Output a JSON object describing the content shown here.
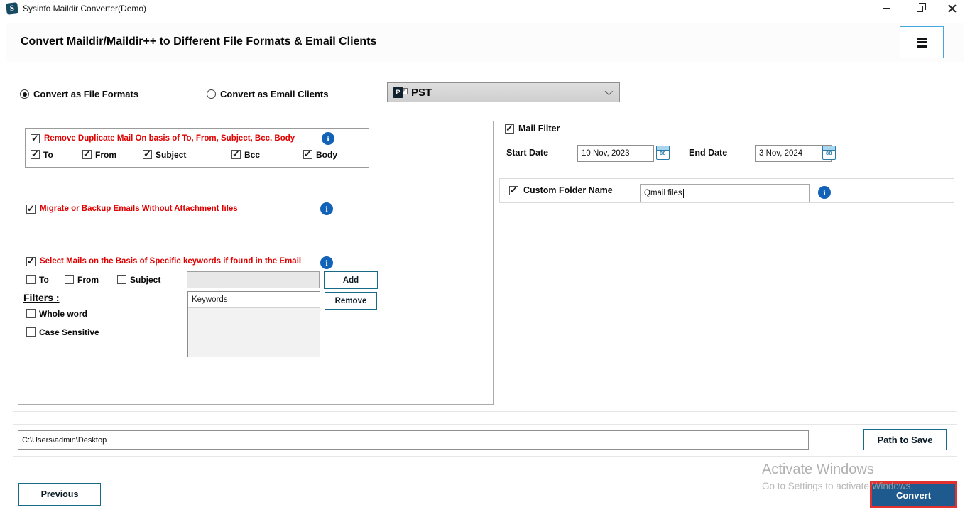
{
  "titlebar": {
    "title": "Sysinfo Maildir Converter(Demo)",
    "icon_letter": "S"
  },
  "header": {
    "title": "Convert Maildir/Maildir++ to Different File Formats & Email Clients"
  },
  "mode": {
    "file_formats": {
      "label": "Convert as File Formats",
      "selected": true
    },
    "email_clients": {
      "label": "Convert as Email Clients",
      "selected": false
    }
  },
  "format_select": {
    "value": "PST",
    "icon_letter": "P"
  },
  "options": {
    "remove_duplicates": {
      "label": "Remove Duplicate Mail On basis of To, From, Subject, Bcc, Body",
      "checked": true,
      "fields": [
        {
          "label": "To",
          "checked": true
        },
        {
          "label": "From",
          "checked": true
        },
        {
          "label": "Subject",
          "checked": true
        },
        {
          "label": "Bcc",
          "checked": true
        },
        {
          "label": "Body",
          "checked": true
        }
      ]
    },
    "no_attachments": {
      "label": "Migrate or Backup Emails Without Attachment files",
      "checked": true
    },
    "keywords_section": {
      "label": "Select Mails on the Basis of Specific keywords if found in the Email",
      "checked": true,
      "fields": [
        {
          "label": "To",
          "checked": false
        },
        {
          "label": "From",
          "checked": false
        },
        {
          "label": "Subject",
          "checked": false
        }
      ],
      "keyword_input_value": "",
      "add_label": "Add",
      "remove_label": "Remove",
      "list_header": "Keywords",
      "filters_label": "Filters :",
      "filters": [
        {
          "label": "Whole word",
          "checked": false
        },
        {
          "label": "Case Sensitive",
          "checked": false
        }
      ]
    }
  },
  "mail_filter": {
    "label": "Mail Filter",
    "checked": true,
    "start_date": {
      "label": "Start Date",
      "value": "10 Nov, 2023"
    },
    "end_date": {
      "label": "End Date",
      "value": "3 Nov, 2024"
    }
  },
  "custom_folder": {
    "label": "Custom Folder Name",
    "checked": true,
    "value": "Qmail files"
  },
  "save_path": {
    "value": "C:\\Users\\admin\\Desktop",
    "button_label": "Path to Save"
  },
  "footer": {
    "previous_label": "Previous",
    "convert_label": "Convert"
  },
  "watermark": {
    "line1": "Activate Windows",
    "line2": "Go to Settings to activate Windows."
  },
  "icons": {
    "info": "i",
    "menu": "hamburger",
    "dropdown_chevron": "chevron-down",
    "calendar": "calendar",
    "check": "✓"
  },
  "colors": {
    "option_red": "#e00000",
    "info_blue": "#1262b8",
    "button_border_teal": "#176b87",
    "convert_blue": "#1e5a8e",
    "convert_highlight_red": "#e23131",
    "menu_border_blue": "#45a7dd"
  }
}
